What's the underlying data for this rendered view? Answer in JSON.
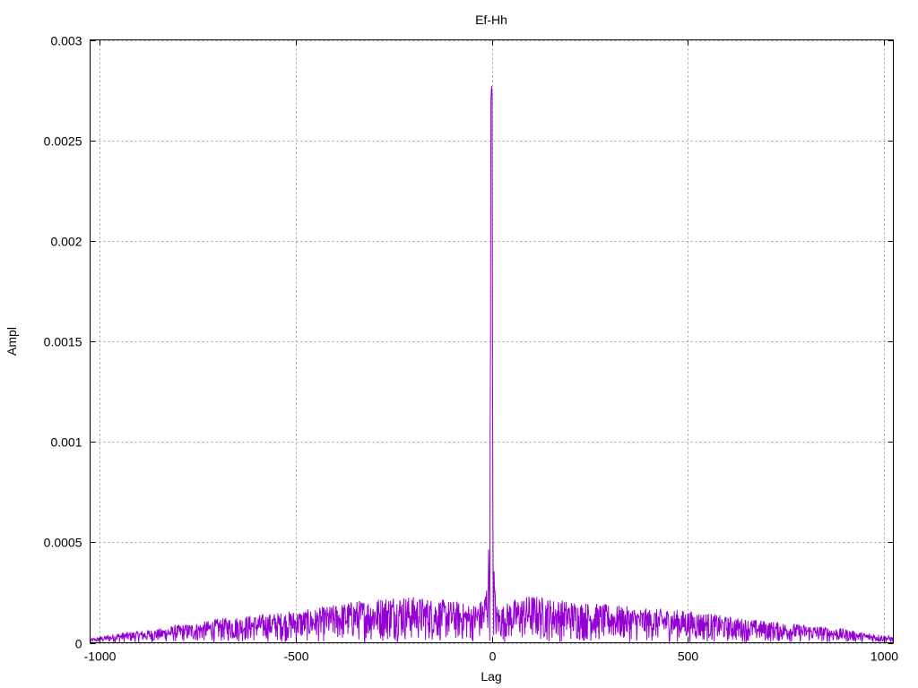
{
  "chart_data": {
    "type": "line",
    "title": "Ef-Hh",
    "xlabel": "Lag",
    "ylabel": "Ampl",
    "xlim": [
      -1025,
      1025
    ],
    "ylim": [
      0,
      0.003
    ],
    "x_ticks": [
      -1000,
      -500,
      0,
      500,
      1000
    ],
    "x_tick_labels": [
      "-1000",
      "-500",
      "0",
      "500",
      "1000"
    ],
    "y_ticks": [
      0,
      0.0005,
      0.001,
      0.0015,
      0.002,
      0.0025,
      0.003
    ],
    "y_tick_labels": [
      "0",
      "0.0005",
      "0.001",
      "0.0015",
      "0.002",
      "0.0025",
      "0.003"
    ],
    "grid": true,
    "legend": "none",
    "series_color": "#9400D3",
    "series": [
      {
        "x": [
          -1024,
          -1000,
          -950,
          -900,
          -850,
          -800,
          -750,
          -700,
          -650,
          -600,
          -550,
          -500,
          -450,
          -400,
          -350,
          -300,
          -250,
          -200,
          -150,
          -100,
          -50,
          -20,
          -10,
          -5,
          -3,
          -2,
          -1,
          0,
          1,
          2,
          3,
          5,
          10,
          20,
          50,
          100,
          150,
          200,
          250,
          300,
          350,
          400,
          450,
          500,
          550,
          600,
          650,
          700,
          750,
          800,
          850,
          900,
          950,
          1000,
          1024
        ],
        "envelope": [
          2e-05,
          3e-05,
          5e-05,
          6e-05,
          7e-05,
          9e-05,
          0.0001,
          0.00012,
          0.00013,
          0.00014,
          0.00015,
          0.00016,
          0.00017,
          0.00019,
          0.00021,
          0.00022,
          0.00024,
          0.00023,
          0.00022,
          0.00021,
          0.00019,
          0.00022,
          0.00035,
          0.00072,
          0.0015,
          0.0027,
          0.00275,
          0.00277,
          0.00272,
          0.00145,
          0.0006,
          0.00045,
          0.0002,
          0.00018,
          0.00021,
          0.00024,
          0.00022,
          0.00021,
          0.0002,
          0.00019,
          0.00018,
          0.00017,
          0.00017,
          0.00016,
          0.00015,
          0.00013,
          0.00012,
          0.00011,
          0.0001,
          9e-05,
          8e-05,
          7e-05,
          5e-05,
          4e-05,
          3e-05
        ]
      }
    ]
  }
}
